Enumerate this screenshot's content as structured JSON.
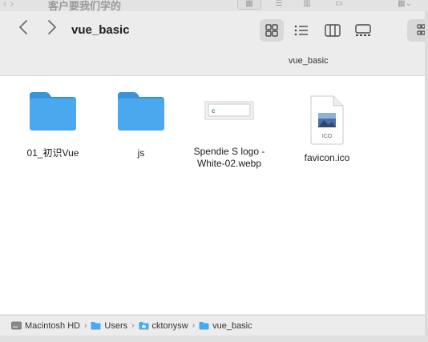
{
  "background_window": {
    "title": "客户要我们学的"
  },
  "toolbar": {
    "title": "vue_basic",
    "path_label": "vue_basic",
    "back_icon": "chevron-left-icon",
    "forward_icon": "chevron-right-icon"
  },
  "files": [
    {
      "name": "01_初识Vue",
      "type": "folder"
    },
    {
      "name": "js",
      "type": "folder"
    },
    {
      "name": "Spendie S logo - White-02.webp",
      "line1": "Spendie S logo -",
      "line2": "White-02.webp",
      "type": "image"
    },
    {
      "name": "favicon.ico",
      "type": "ico",
      "badge": "ICO"
    }
  ],
  "pathbar": {
    "items": [
      "Macintosh HD",
      "Users",
      "cktonysw",
      "vue_basic"
    ]
  },
  "colors": {
    "folder": "#4aa8ee",
    "folder_dark": "#3a93d9"
  }
}
